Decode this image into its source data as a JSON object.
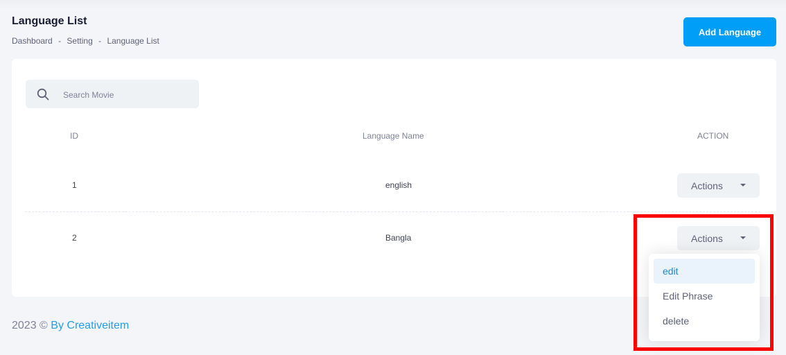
{
  "header": {
    "title": "Language List",
    "breadcrumb": [
      "Dashboard",
      "Setting",
      "Language List"
    ],
    "separator": "-",
    "add_button": "Add Language"
  },
  "search": {
    "placeholder": "Search Movie",
    "icon": "search-icon"
  },
  "table": {
    "columns": [
      "ID",
      "Language Name",
      "ACTION"
    ],
    "rows": [
      {
        "id": "1",
        "name": "english",
        "action": "Actions"
      },
      {
        "id": "2",
        "name": "Bangla",
        "action": "Actions"
      }
    ]
  },
  "dropdown": {
    "items": [
      "edit",
      "Edit Phrase",
      "delete"
    ],
    "active_index": 0
  },
  "footer": {
    "prefix": "2023 ©",
    "link": "By Creativeitem"
  },
  "colors": {
    "primary": "#009ef7",
    "link": "#1e9ff2",
    "highlight": "#ff0000",
    "background": "#f4f5f8"
  }
}
